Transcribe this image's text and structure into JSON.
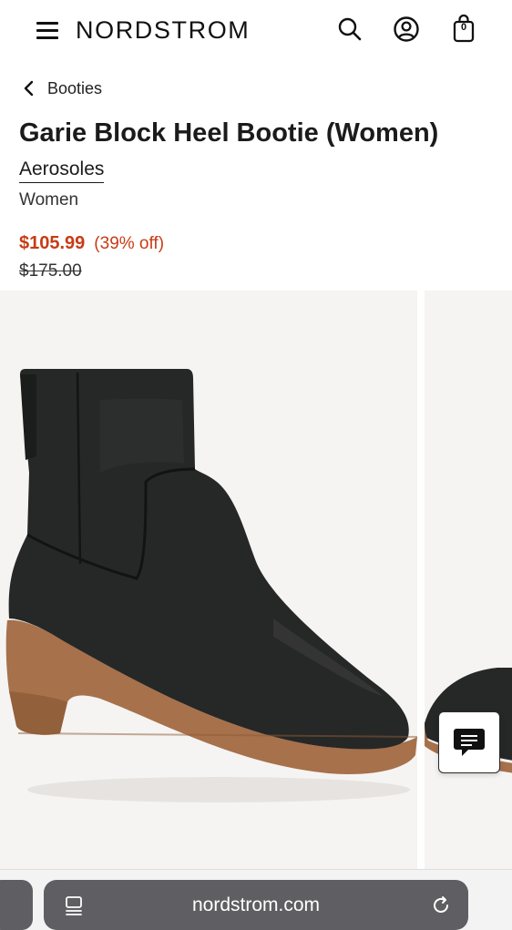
{
  "header": {
    "brand": "NORDSTROM",
    "menu_icon": "hamburger-menu-icon",
    "search_icon": "search-icon",
    "account_icon": "account-icon",
    "bag_icon": "shopping-bag-icon",
    "bag_count": "0"
  },
  "breadcrumb": {
    "label": "Booties",
    "icon": "chevron-left-icon"
  },
  "product": {
    "title": "Garie Block Heel Bootie (Women)",
    "brand": "Aerosoles",
    "category": "Women",
    "price_sale": "$105.99",
    "discount": "(39% off)",
    "price_original": "$175.00"
  },
  "chat": {
    "icon": "chat-bubble-icon"
  },
  "browser": {
    "url": "nordstrom.com",
    "page_icon": "page-menu-icon",
    "reload_icon": "reload-icon"
  },
  "colors": {
    "sale_red": "#c63c16",
    "text": "#1b1b1b",
    "image_bg": "#f5f4f3",
    "browser_pill": "#5f5f63"
  }
}
